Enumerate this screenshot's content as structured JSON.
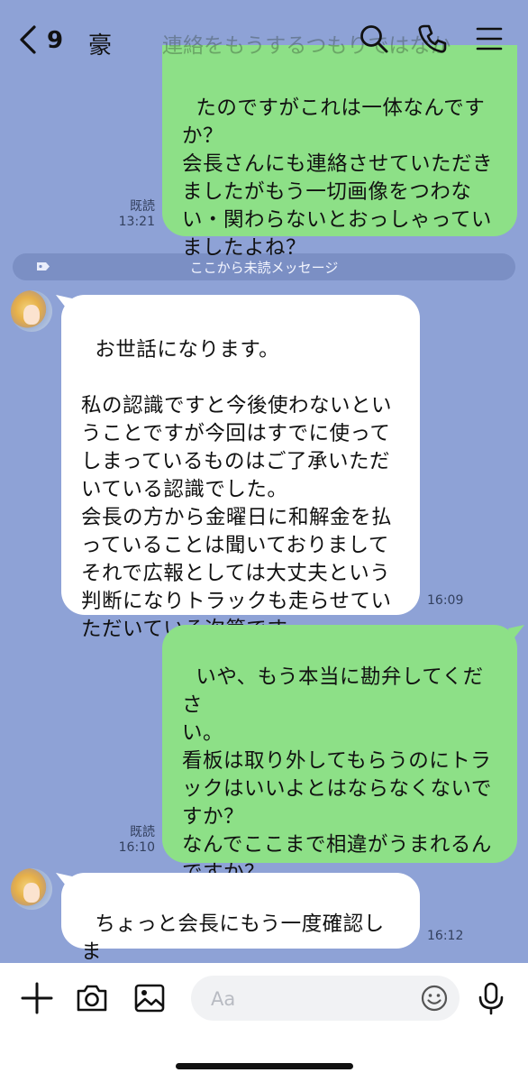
{
  "header": {
    "back_count": "9",
    "chat_name": "豪",
    "faded_preview": "連絡をもうするつもりではなか"
  },
  "messages": [
    {
      "side": "me",
      "text": "たのですがこれは一体なんです\nか？\n会長さんにも連絡させていただき\nましたがもう一切画像をつわな\nい・関わらないとおっしゃってい\nましたよね？",
      "read": "既読",
      "time": "13:21"
    },
    {
      "side": "them",
      "text": "お世話になります。\n\n私の認識ですと今後使わないとい\nうことですが今回はすでに使って\nしまっているものはご了承いただ\nいている認識でした。\n会長の方から金曜日に和解金を払\nっていることは聞いておりまして\nそれで広報としては大丈夫という\n判断になりトラックも走らせてい\nただいている次第です",
      "time": "16:09"
    },
    {
      "side": "me",
      "text": "いや、もう本当に勘弁してくださ\nい。\n看板は取り外してもらうのにトラ\nックはいいよとはならなくないで\nすか？\nなんでここまで相違がうまれるん\nですか？\n疲れます…",
      "read": "既読",
      "time": "16:10"
    },
    {
      "side": "them",
      "text": "ちょっと会長にもう一度確認しま\nすね",
      "time": "16:12"
    }
  ],
  "unread_label": "ここから未読メッセージ",
  "input": {
    "placeholder": "Aa"
  },
  "colors": {
    "background": "#8ea2d6",
    "my_bubble": "#8de087",
    "their_bubble": "#ffffff"
  }
}
